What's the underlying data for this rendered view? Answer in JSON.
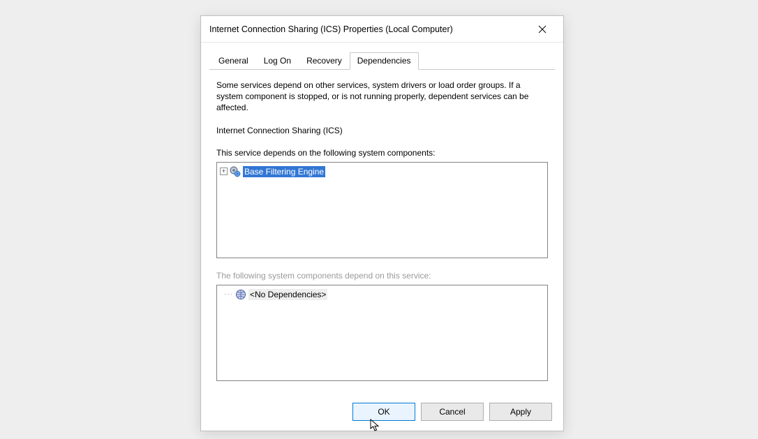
{
  "window": {
    "title": "Internet Connection Sharing (ICS) Properties (Local Computer)"
  },
  "tabs": {
    "general": "General",
    "logon": "Log On",
    "recovery": "Recovery",
    "dependencies": "Dependencies",
    "active": "dependencies"
  },
  "dependencies_panel": {
    "description": "Some services depend on other services, system drivers or load order groups. If a system component is stopped, or is not running properly, dependent services can be affected.",
    "service_name": "Internet Connection Sharing (ICS)",
    "depends_on_label": "This service depends on the following system components:",
    "depends_on_items": [
      {
        "label": "Base Filtering Engine",
        "expandable": true,
        "selected": true
      }
    ],
    "dependents_label": "The following system components depend on this service:",
    "dependents_items": [
      {
        "label": "<No Dependencies>",
        "expandable": false,
        "selected": false
      }
    ]
  },
  "buttons": {
    "ok": "OK",
    "cancel": "Cancel",
    "apply": "Apply"
  }
}
